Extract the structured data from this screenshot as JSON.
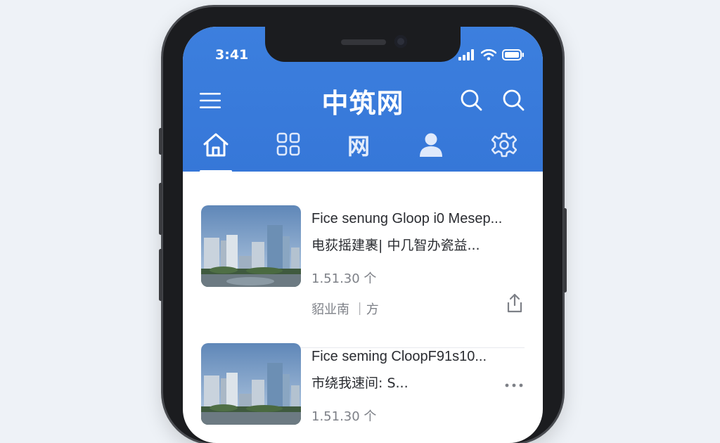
{
  "status_bar": {
    "time": "3:41"
  },
  "header": {
    "title": "中筑网"
  },
  "tabs": [
    {
      "name": "home",
      "label": ""
    },
    {
      "name": "grid",
      "label": ""
    },
    {
      "name": "net",
      "label": "网"
    },
    {
      "name": "profile",
      "label": ""
    },
    {
      "name": "settings",
      "label": ""
    }
  ],
  "articles": [
    {
      "title": "Fice senung Gloop i0 Mesep...",
      "subtitle": "电荻摇建裹| 中几智办瓷益...",
      "meta": "1.51.30 个",
      "source": "貂业南 ｜方"
    },
    {
      "title": "Fice seming CloopF91s10...",
      "subtitle": "市绕我速间: S...",
      "meta": "1.51.30 个",
      "source": ""
    }
  ],
  "colors": {
    "accent": "#3677d8",
    "frame": "#1b1c1f",
    "text": "#2a2c31",
    "muted": "#7d8087"
  }
}
